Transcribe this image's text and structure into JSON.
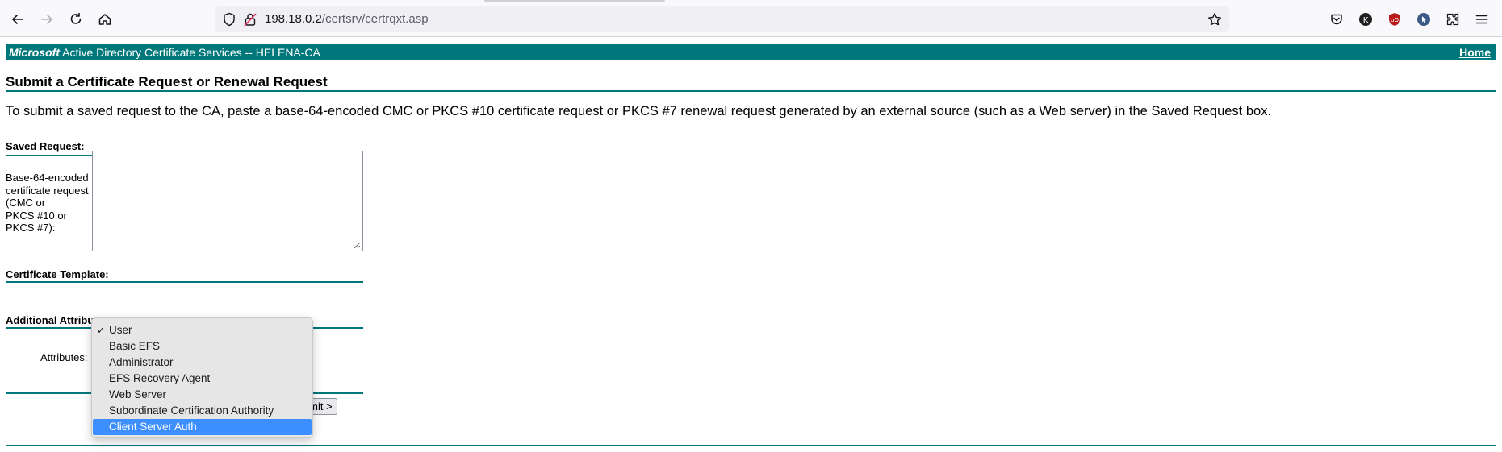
{
  "browser": {
    "url_host": "198.18.0.2",
    "url_path": "/certsrv/certrqxt.asp",
    "icons": [
      "back-icon",
      "forward-icon",
      "reload-icon",
      "home-icon",
      "shield-icon",
      "insecure-lock-icon",
      "bookmark-star-icon",
      "pocket-icon",
      "extension-icon",
      "ublock-icon",
      "extension-icon",
      "extensions-icon",
      "menu-icon"
    ]
  },
  "header": {
    "brand": "Microsoft",
    "product": "Active Directory Certificate Services",
    "separator": "--",
    "ca_name": "HELENA-CA",
    "home_link": "Home"
  },
  "main": {
    "title": "Submit a Certificate Request or Renewal Request",
    "intro": "To submit a saved request to the CA, paste a base-64-encoded CMC or PKCS #10 certificate request or PKCS #7 renewal request generated by an external source (such as a Web server) in the Saved Request box.",
    "saved_request_heading": "Saved Request:",
    "request_field_label_lines": [
      "Base-64-encoded",
      "certificate request",
      "(CMC or",
      "PKCS #10 or",
      "PKCS #7):"
    ],
    "request_value": "",
    "template_heading": "Certificate Template:",
    "additional_heading": "Additional Attribu",
    "attributes_label": "Attributes:",
    "submit_label": "Submit >"
  },
  "template_dropdown": {
    "selected": "User",
    "highlighted": "Client Server Auth",
    "options": [
      "User",
      "Basic EFS",
      "Administrator",
      "EFS Recovery Agent",
      "Web Server",
      "Subordinate Certification Authority",
      "Client Server Auth"
    ]
  },
  "colors": {
    "accent": "#00777a",
    "highlight": "#3d8eff"
  }
}
